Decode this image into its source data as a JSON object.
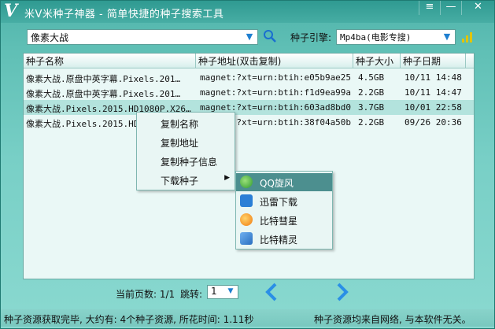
{
  "window": {
    "title": "米V米种子神器 - 简单快捷的种子搜索工具",
    "logo": "V",
    "controls": [
      "≡",
      "—",
      "✕"
    ]
  },
  "search": {
    "query": "像素大战",
    "engine_label": "种子引擎:",
    "engine_value": "Mp4ba(电影专搜)"
  },
  "table": {
    "columns": [
      "种子名称",
      "种子地址(双击复制)",
      "种子大小",
      "种子日期"
    ],
    "rows": [
      {
        "name": "像素大战.原盘中英字幕.Pixels.201…",
        "address": "magnet:?xt=urn:btih:e05b9ae25…",
        "size": "4.5GB",
        "date": "10/11 14:48"
      },
      {
        "name": "像素大战.原盘中英字幕.Pixels.201…",
        "address": "magnet:?xt=urn:btih:f1d9ea99a…",
        "size": "2.2GB",
        "date": "10/11 14:47"
      },
      {
        "name": "像素大战.Pixels.2015.HD1080P.X26…",
        "address": "magnet:?xt=urn:btih:603ad8bd0…",
        "size": "3.7GB",
        "date": "10/01 22:58"
      },
      {
        "name": "像素大战.Pixels.2015.HD",
        "address": "magnet:?xt=urn:btih:38f04a50b…",
        "size": "2.2GB",
        "date": "09/26 20:36"
      }
    ]
  },
  "context_menu": {
    "items": [
      "复制名称",
      "复制地址",
      "复制种子信息",
      "下载种子"
    ]
  },
  "download_submenu": {
    "items": [
      "QQ旋风",
      "迅雷下载",
      "比特彗星",
      "比特精灵"
    ]
  },
  "pager": {
    "current_label": "当前页数: 1/1",
    "jump_label": "跳转:",
    "jump_value": "1"
  },
  "status": {
    "left": "种子资源获取完毕, 大约有: 4个种子资源, 所花时间: 1.11秒",
    "right": "种子资源均来自网络, 与本软件无关。"
  },
  "colors": {
    "accent": "#1f8fe0",
    "titlebar": "#2f9a91",
    "selection": "#b3e3dd"
  }
}
